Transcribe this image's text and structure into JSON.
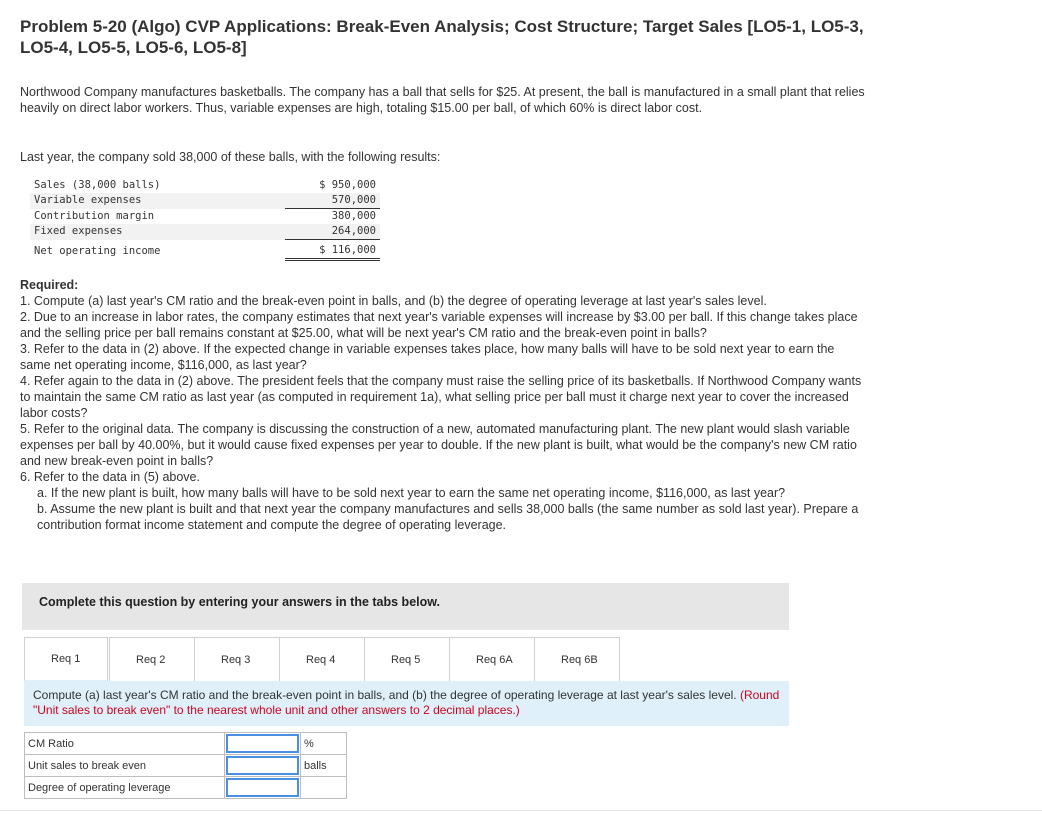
{
  "title": "Problem 5-20 (Algo) CVP Applications: Break-Even Analysis; Cost Structure; Target Sales [LO5-1, LO5-3, LO5-4, LO5-5, LO5-6, LO5-8]",
  "intro": "Northwood Company manufactures basketballs. The company has a ball that sells for $25. At present, the ball is manufactured in a small plant that relies heavily on direct labor workers. Thus, variable expenses are high, totaling $15.00 per ball, of which 60% is direct labor cost.",
  "last_year": "Last year, the company sold 38,000 of these balls, with the following results:",
  "statement": [
    {
      "label": "Sales (38,000 balls)",
      "amount": "$ 950,000"
    },
    {
      "label": "Variable expenses",
      "amount": "570,000"
    },
    {
      "label": "Contribution margin",
      "amount": "380,000"
    },
    {
      "label": "Fixed expenses",
      "amount": "264,000"
    },
    {
      "label": "Net operating income",
      "amount": "$ 116,000"
    }
  ],
  "required": {
    "heading": "Required:",
    "items": [
      "1. Compute (a) last year's CM ratio and the break-even point in balls, and (b) the degree of operating leverage at last year's sales level.",
      "2. Due to an increase in labor rates, the company estimates that next year's variable expenses will increase by $3.00 per ball. If this change takes place and the selling price per ball remains constant at $25.00, what will be next year's CM ratio and the break-even point in balls?",
      "3. Refer to the data in (2) above. If the expected change in variable expenses takes place, how many balls will have to be sold next year to earn the same net operating income, $116,000, as last year?",
      "4. Refer again to the data in (2) above. The president feels that the company must raise the selling price of its basketballs. If Northwood Company wants to maintain the same CM ratio as last year (as computed in requirement 1a), what selling price per ball must it charge next year to cover the increased labor costs?",
      "5. Refer to the original data. The company is discussing the construction of a new, automated manufacturing plant. The new plant would slash variable expenses per ball by 40.00%, but it would cause fixed expenses per year to double. If the new plant is built, what would be the company's new CM ratio and new break-even point in balls?",
      "6. Refer to the data in (5) above."
    ],
    "sub_items": [
      "a. If the new plant is built, how many balls will have to be sold next year to earn the same net operating income, $116,000, as last year?",
      "b. Assume the new plant is built and that next year the company manufactures and sells 38,000 balls (the same number as sold last year). Prepare a contribution format income statement and compute the degree of operating leverage."
    ]
  },
  "instruction": "Complete this question by entering your answers in the tabs below.",
  "tabs": [
    "Req 1",
    "Req 2",
    "Req 3",
    "Req 4",
    "Req 5",
    "Req 6A",
    "Req 6B"
  ],
  "question": {
    "text": "Compute (a) last year's CM ratio and the break-even point in balls, and (b) the degree of operating leverage at last year's sales level.",
    "note": "(Round \"Unit sales to break even\" to the nearest whole unit and other answers to 2 decimal places.)"
  },
  "answers": [
    {
      "label": "CM Ratio",
      "value": "",
      "unit": "%"
    },
    {
      "label": "Unit sales to break even",
      "value": "",
      "unit": "balls"
    },
    {
      "label": "Degree of operating leverage",
      "value": "",
      "unit": ""
    }
  ],
  "colors": {
    "question_bg": "#dff0fb",
    "instruction_bg": "#e6e6e6",
    "note_red": "#d0021b",
    "input_border": "#4a90e2"
  }
}
